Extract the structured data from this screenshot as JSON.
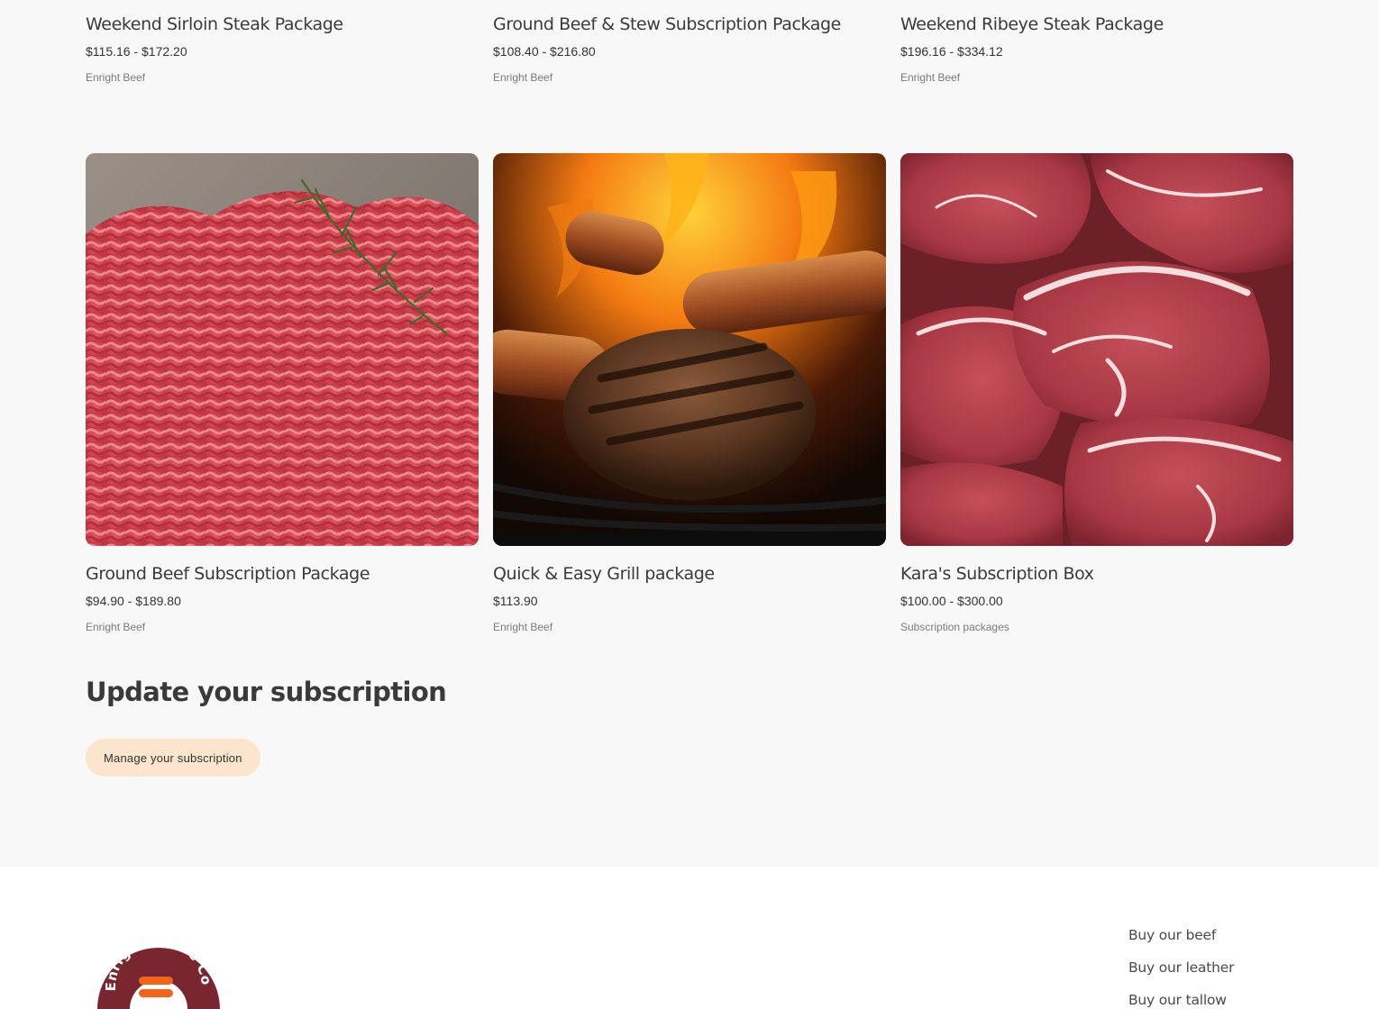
{
  "products_top": [
    {
      "title": "Weekend Sirloin Steak Package",
      "price": "$115.16 - $172.20",
      "vendor": "Enright Beef"
    },
    {
      "title": "Ground Beef & Stew Subscription Package",
      "price": "$108.40 - $216.80",
      "vendor": "Enright Beef"
    },
    {
      "title": "Weekend Ribeye Steak Package",
      "price": "$196.16 - $334.12",
      "vendor": "Enright Beef"
    }
  ],
  "products_bottom": [
    {
      "title": "Ground Beef Subscription Package",
      "price": "$94.90 - $189.80",
      "vendor": "Enright Beef",
      "image_icon": "ground-beef-photo"
    },
    {
      "title": "Quick & Easy Grill package",
      "price": "$113.90",
      "vendor": "Enright Beef",
      "image_icon": "grill-burger-photo"
    },
    {
      "title": "Kara's Subscription Box",
      "price": "$100.00 - $300.00",
      "vendor": "Subscription packages",
      "image_icon": "raw-steaks-photo"
    }
  ],
  "update": {
    "title": "Update your subscription",
    "button_label": "Manage your subscription"
  },
  "footer": {
    "logo_text": "Enright Cattle Co.",
    "links": [
      "Buy our beef",
      "Buy our leather",
      "Buy our tallow"
    ]
  },
  "colors": {
    "page_bg": "#f8f8f8",
    "button_bg": "#fbe5cc",
    "logo_maroon": "#7a2630",
    "logo_orange": "#f26418"
  }
}
